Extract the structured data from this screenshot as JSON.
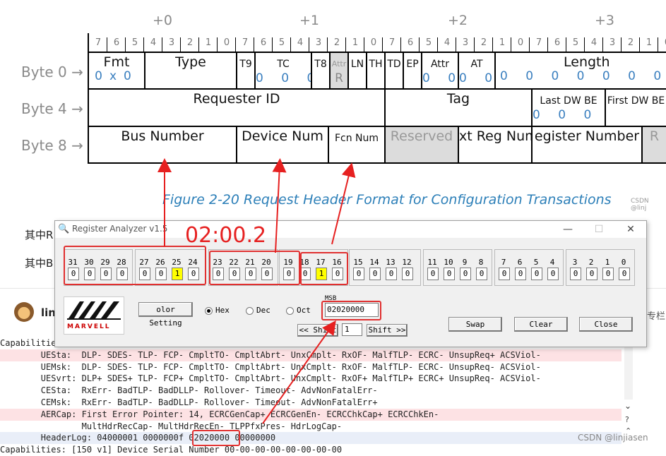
{
  "diagram": {
    "byte_offsets": [
      "+0",
      "+1",
      "+2",
      "+3"
    ],
    "bit_numbers": [
      "7",
      "6",
      "5",
      "4",
      "3",
      "2",
      "1",
      "0"
    ],
    "row_labels": [
      "Byte 0 →",
      "Byte 4 →",
      "Byte 8 →"
    ],
    "row0": {
      "fmt": "Fmt",
      "fmt_val": "0x0",
      "type": "Type",
      "t9": "T9",
      "tc": "TC",
      "tc_val": "0 0 0",
      "t8": "T8",
      "attr_r": "Attr",
      "attr_r_val": "R",
      "ln": "LN",
      "th": "TH",
      "td": "TD",
      "ep": "EP",
      "attr": "Attr",
      "attr_val": "0 0",
      "at": "AT",
      "at_val": "0 0",
      "length": "Length",
      "length_val": "0 0 0 0 0 0 0 0 0 0 1"
    },
    "row1": {
      "requester": "Requester ID",
      "tag": "Tag",
      "last_be": "Last DW BE",
      "last_be_val": "0 0 0 0",
      "first_be": "First DW BE"
    },
    "row2": {
      "bus": "Bus Number",
      "device": "Device Num",
      "fcn": "Fcn Num",
      "reserved": "Reserved",
      "ext_reg": "xt Reg Num",
      "register": "egister Number",
      "r": "R"
    },
    "caption": "Figure  2-20  Request Header Format for Configuration Transactions",
    "watermark": "CSDN @linj"
  },
  "background_text": {
    "line1": "其中R",
    "line2": "其中B",
    "user": "lin",
    "right_label": "专栏"
  },
  "annotation": "02:00.2",
  "dialog": {
    "title": "Register Analyzer v1.5",
    "min": "—",
    "max": "☐",
    "close": "✕",
    "groups": [
      {
        "labels": [
          "31",
          "30",
          "29",
          "28"
        ],
        "values": [
          "0",
          "0",
          "0",
          "0"
        ]
      },
      {
        "labels": [
          "27",
          "26",
          "25",
          "24"
        ],
        "values": [
          "0",
          "0",
          "1",
          "0"
        ]
      },
      {
        "labels": [
          "23",
          "22",
          "21",
          "20"
        ],
        "values": [
          "0",
          "0",
          "0",
          "0"
        ]
      },
      {
        "labels": [
          "19",
          "18",
          "17",
          "16"
        ],
        "values": [
          "0",
          "0",
          "1",
          "0"
        ]
      },
      {
        "labels": [
          "15",
          "14",
          "13",
          "12"
        ],
        "values": [
          "0",
          "0",
          "0",
          "0"
        ]
      },
      {
        "labels": [
          "11",
          "10",
          "9",
          "8"
        ],
        "values": [
          "0",
          "0",
          "0",
          "0"
        ]
      },
      {
        "labels": [
          "7",
          "6",
          "5",
          "4"
        ],
        "values": [
          "0",
          "0",
          "0",
          "0"
        ]
      },
      {
        "labels": [
          "3",
          "2",
          "1",
          "0"
        ],
        "values": [
          "0",
          "0",
          "0",
          "0"
        ]
      }
    ],
    "logo": "MARVELL",
    "color_setting": "olor Setting",
    "radio_hex": "Hex",
    "radio_dec": "Dec",
    "radio_oct": "Oct",
    "msb_label": "MSB",
    "msb_value": "02020000",
    "shift_left": "<< Shift",
    "shift_count": "1",
    "shift_right": "Shift >>",
    "swap": "Swap",
    "clear": "Clear",
    "close_btn": "Close"
  },
  "terminal": {
    "lines": [
      "Capabilities: [...",
      "        UESta:  DLP- SDES- TLP- FCP- CmpltTO- CmpltAbrt- UnxCmplt- RxOF- MalfTLP- ECRC- UnsupReq+ ACSViol-",
      "        UEMsk:  DLP- SDES- TLP- FCP- CmpltTO- CmpltAbrt- UnxCmplt- RxOF- MalfTLP- ECRC- UnsupReq- ACSViol-",
      "        UESvrt: DLP+ SDES+ TLP- FCP+ CmpltTO- CmpltAbrt- UnxCmplt- RxOF+ MalfTLP+ ECRC+ UnsupReq- ACSViol-",
      "        CESta:  RxErr- BadTLP- BadDLLP- Rollover- Timeout- AdvNonFatalErr-",
      "        CEMsk:  RxErr- BadTLP- BadDLLP- Rollover- Timeout- AdvNonFatalErr+",
      "        AERCap: First Error Pointer: 14, ECRCGenCap+ ECRCGenEn- ECRCChkCap+ ECRCChkEn-",
      "                MultHdrRecCap- MultHdrRecEn- TLPPfxPres- HdrLogCap-",
      "        HeaderLog: 04000001 0000000f 02020000 00000000",
      "Capabilities: [150 v1] Device Serial Number 00-00-00-00-00-00-00-00"
    ],
    "watermark": "CSDN @linjiasen"
  }
}
